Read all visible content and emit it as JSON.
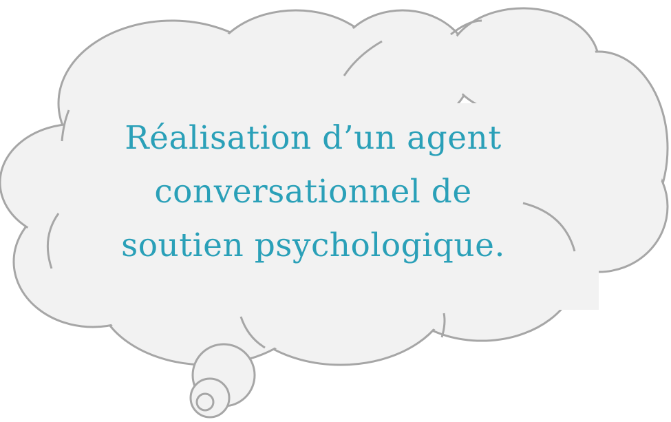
{
  "bubble": {
    "lines": [
      "Réalisation d’un agent",
      "conversationnel de",
      "soutien psychologique."
    ]
  },
  "colors": {
    "fill": "#f2f2f2",
    "outline": "#a6a6a6",
    "text": "#2aa0b8"
  }
}
